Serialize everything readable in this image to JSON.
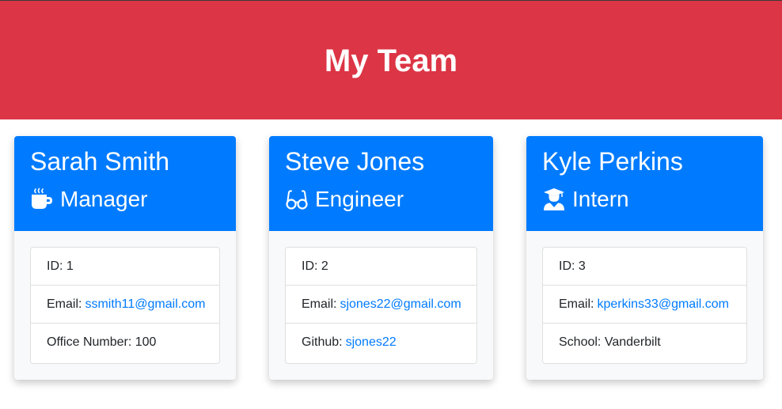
{
  "header": {
    "title": "My Team"
  },
  "colors": {
    "banner": "#dc3545",
    "card_header": "#007bff",
    "link": "#007bff"
  },
  "cards": [
    {
      "name": "Sarah Smith",
      "role": "Manager",
      "role_icon": "coffee-cup-icon",
      "details": [
        {
          "label": "ID:",
          "value": "1"
        },
        {
          "label": "Email:",
          "value": "ssmith11@gmail.com"
        },
        {
          "label": "Office Number:",
          "value": "100"
        }
      ]
    },
    {
      "name": "Steve Jones",
      "role": "Engineer",
      "role_icon": "glasses-icon",
      "details": [
        {
          "label": "ID:",
          "value": "2"
        },
        {
          "label": "Email:",
          "value": "sjones22@gmail.com"
        },
        {
          "label": "Github:",
          "value": "sjones22"
        }
      ]
    },
    {
      "name": "Kyle Perkins",
      "role": "Intern",
      "role_icon": "graduate-icon",
      "details": [
        {
          "label": "ID:",
          "value": "3"
        },
        {
          "label": "Email:",
          "value": "kperkins33@gmail.com"
        },
        {
          "label": "School:",
          "value": "Vanderbilt"
        }
      ]
    }
  ]
}
